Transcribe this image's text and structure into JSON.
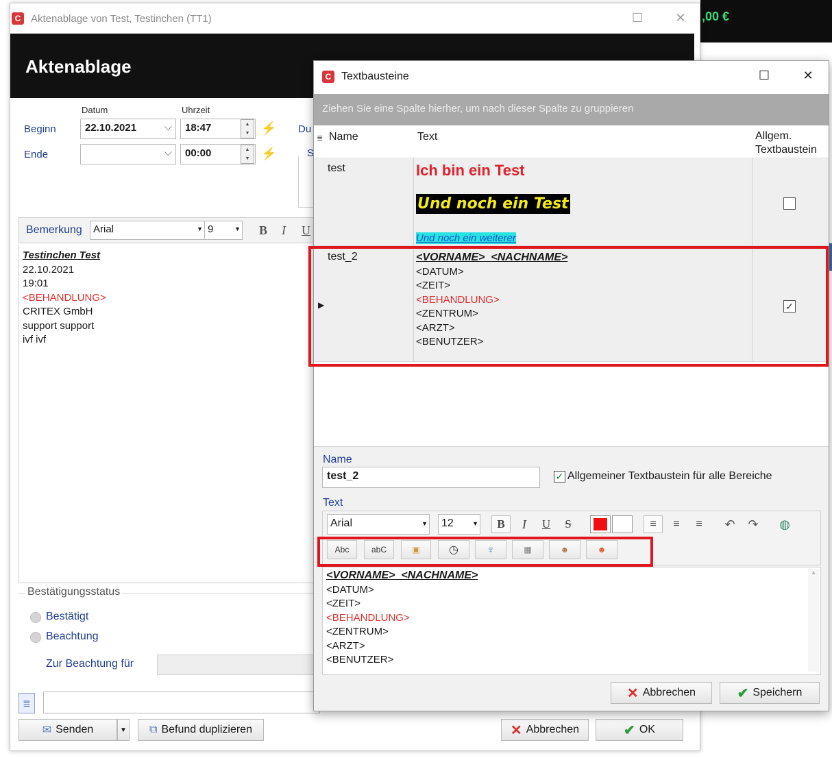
{
  "background": {
    "balance": ",00 €"
  },
  "main_window": {
    "title": "Aktenablage von Test, Testinchen (TT1)",
    "header": "Aktenablage",
    "labels": {
      "datum": "Datum",
      "uhrzeit": "Uhrzeit",
      "beginn": "Beginn",
      "ende": "Ende",
      "du": "Du",
      "s": "S"
    },
    "beginn_date": "22.10.2021",
    "beginn_time": "18:47",
    "ende_date": "",
    "ende_time": "00:00",
    "bemerkung": {
      "label": "Bemerkung",
      "font": "Arial",
      "size": "9"
    },
    "note": {
      "title": "Testinchen Test",
      "lines": [
        "22.10.2021",
        "19:01",
        "<BEHANDLUNG>",
        "CRITEX GmbH",
        "support support",
        "ivf ivf"
      ]
    },
    "status": {
      "legend": "Bestätigungsstatus",
      "bestaetigt": "Bestätigt",
      "beachtung": "Beachtung",
      "zur_beachtung": "Zur Beachtung für"
    },
    "buttons": {
      "senden": "Senden",
      "befund": "Befund duplizieren",
      "abbrechen": "Abbrechen",
      "ok": "OK"
    }
  },
  "dialog": {
    "title": "Textbausteine",
    "group_hint": "Ziehen Sie eine Spalte hierher, um nach dieser Spalte zu gruppieren",
    "columns": {
      "name": "Name",
      "text": "Text",
      "allgem_line1": "Allgem.",
      "allgem_line2": "Textbaustein"
    },
    "rows": [
      {
        "name": "test",
        "line1": "Ich bin ein Test",
        "line2": "Und noch ein Test",
        "line3": "Und noch ein weiterer",
        "allgem": false
      },
      {
        "name": "test_2",
        "first": "<VORNAME>  <NACHNAME>",
        "lines": [
          "<DATUM>",
          "<ZEIT>",
          "<BEHANDLUNG>",
          "<ZENTRUM>",
          "<ARZT>",
          "<BENUTZER>"
        ],
        "allgem": true
      }
    ],
    "name_label": "Name",
    "name_value": "test_2",
    "allgemein_label": "Allgemeiner Textbaustein für alle Bereiche",
    "text_label": "Text",
    "editor_font": "Arial",
    "editor_size": "12",
    "placeholders": [
      "Abc",
      "abC"
    ],
    "editor": {
      "first": "<VORNAME>  <NACHNAME>",
      "lines": [
        "<DATUM>",
        "<ZEIT>",
        "<BEHANDLUNG>",
        "<ZENTRUM>",
        "<ARZT>",
        "<BENUTZER>"
      ]
    },
    "buttons": {
      "abbrechen": "Abbrechen",
      "speichern": "Speichern"
    }
  },
  "colors": {
    "highlight": "#e0161e",
    "header_bg": "#111111",
    "group_bg": "#a9a9a9",
    "accent_red": "#e0302f"
  }
}
